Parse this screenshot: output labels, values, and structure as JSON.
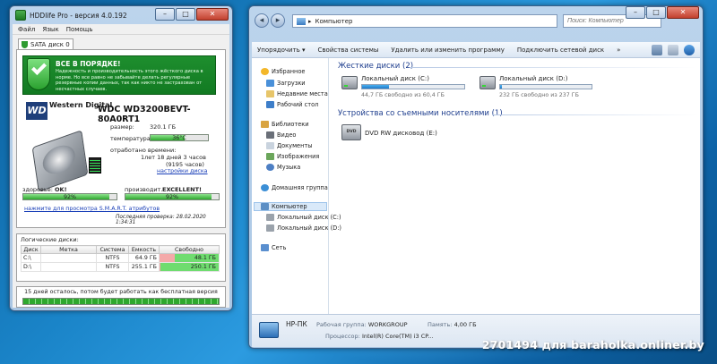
{
  "hddlife": {
    "title": "HDDlife Pro - версия 4.0.192",
    "menu": [
      "Файл",
      "Язык",
      "Помощь"
    ],
    "tab_label": "SATA диск 0",
    "status_title": "ВСЕ В ПОРЯДКЕ!",
    "status_text": "Надежность и производительность этого жёсткого диска в норме. Но все равно не забывайте делать регулярные резервные копии данных, так как никто не застрахован от несчастных случаев.",
    "brand": "Western Digital",
    "brand_mark": "WD",
    "model": "WDC WD3200BEVT-80A0RT1",
    "size_label": "размер:",
    "size_value": "320.1 ГБ",
    "temp_label": "температура",
    "temp_value": "36°C",
    "temp_level": 0.6,
    "uptime_label": "отработано времени:",
    "uptime_value": "1лет 18 дней 3 часов",
    "uptime_hours": "(9195 часов)",
    "settings_link": "настройки диска",
    "health_label": "здоровье:",
    "health_status": "OK!",
    "health_value": "92%",
    "health_level": 0.92,
    "perf_label": "производит.",
    "perf_status": "EXCELLENT!",
    "perf_value": "92%",
    "perf_level": 0.92,
    "smart_link": "нажмите для просмотра S.M.A.R.T. атрибутов",
    "last_check": "Последняя проверка: 28.02.2020 1:34:31",
    "logical_title": "Логические диски:",
    "logical_headers": [
      "Диск",
      "Метка",
      "Система",
      "Емкость",
      "Свободно"
    ],
    "logical_rows": [
      {
        "disk": "C:\\",
        "label": "",
        "fs": "NTFS",
        "capacity": "64.9 ГБ",
        "free": "48.1 ГБ",
        "free_frac": 0.74
      },
      {
        "disk": "D:\\",
        "label": "",
        "fs": "NTFS",
        "capacity": "255.1 ГБ",
        "free": "250.1 ГБ",
        "free_frac": 0.98
      }
    ],
    "trial_text": "15 дней осталось, потом будет работать как бесплатная версия"
  },
  "explorer": {
    "address_root": "▸",
    "address": "Компьютер",
    "search_placeholder": "Поиск: Компьютер",
    "toolbar": [
      "Упорядочить ▾",
      "Свойства системы",
      "Удалить или изменить программу",
      "Подключить сетевой диск",
      "»"
    ],
    "nav": {
      "favorites": "Избранное",
      "downloads": "Загрузки",
      "recent": "Недавние места",
      "desktop": "Рабочий стол",
      "libraries": "Библиотеки",
      "video": "Видео",
      "documents": "Документы",
      "images": "Изображения",
      "music": "Музыка",
      "homegroup": "Домашняя группа",
      "computer": "Компьютер",
      "disk_c": "Локальный диск (C:)",
      "disk_d": "Локальный диск (D:)",
      "network": "Сеть"
    },
    "hdd_group": "Жесткие диски (2)",
    "drives": [
      {
        "name": "Локальный диск (C:)",
        "free": "44,7 ГБ свободно из 60,4 ГБ",
        "used_frac": 0.26
      },
      {
        "name": "Локальный диск (D:)",
        "free": "232 ГБ свободно из 237 ГБ",
        "used_frac": 0.02
      }
    ],
    "removable_group": "Устройства со съемными носителями (1)",
    "dvd_name": "DVD RW дисковод (E:)",
    "dvd_mark": "DVD",
    "details": {
      "pc_name": "HP-ПК",
      "workgroup_key": "Рабочая группа:",
      "workgroup": "WORKGROUP",
      "memory_key": "Память:",
      "memory": "4,00 ГБ",
      "cpu_key": "Процессор:",
      "cpu": "Intel(R) Core(TM) i3 CP..."
    }
  },
  "watermark": "2701494 для baraholka.onliner.by",
  "colors": {
    "accent_green": "#1e8e2e",
    "bar_green": "#2ea82e",
    "drive_blue": "#1f79c8"
  }
}
